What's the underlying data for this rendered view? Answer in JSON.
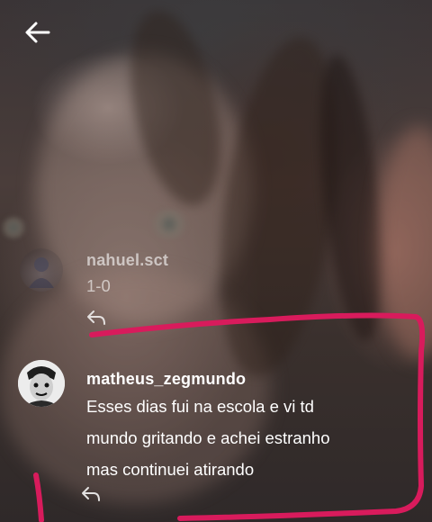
{
  "header": {
    "back_icon": "arrow-left-icon"
  },
  "comments": [
    {
      "username": "nahuel.sct",
      "text": "1-0",
      "reply_icon": "reply-arrow-icon",
      "faded": true
    },
    {
      "username": "matheus_zegmundo",
      "text": "Esses dias fui na escola e vi td\nmundo gritando e achei estranho\nmas continuei atirando",
      "reply_icon": "reply-arrow-icon",
      "faded": false
    }
  ],
  "colors": {
    "annotation_stroke": "#d81b5c",
    "text": "#ffffff"
  }
}
